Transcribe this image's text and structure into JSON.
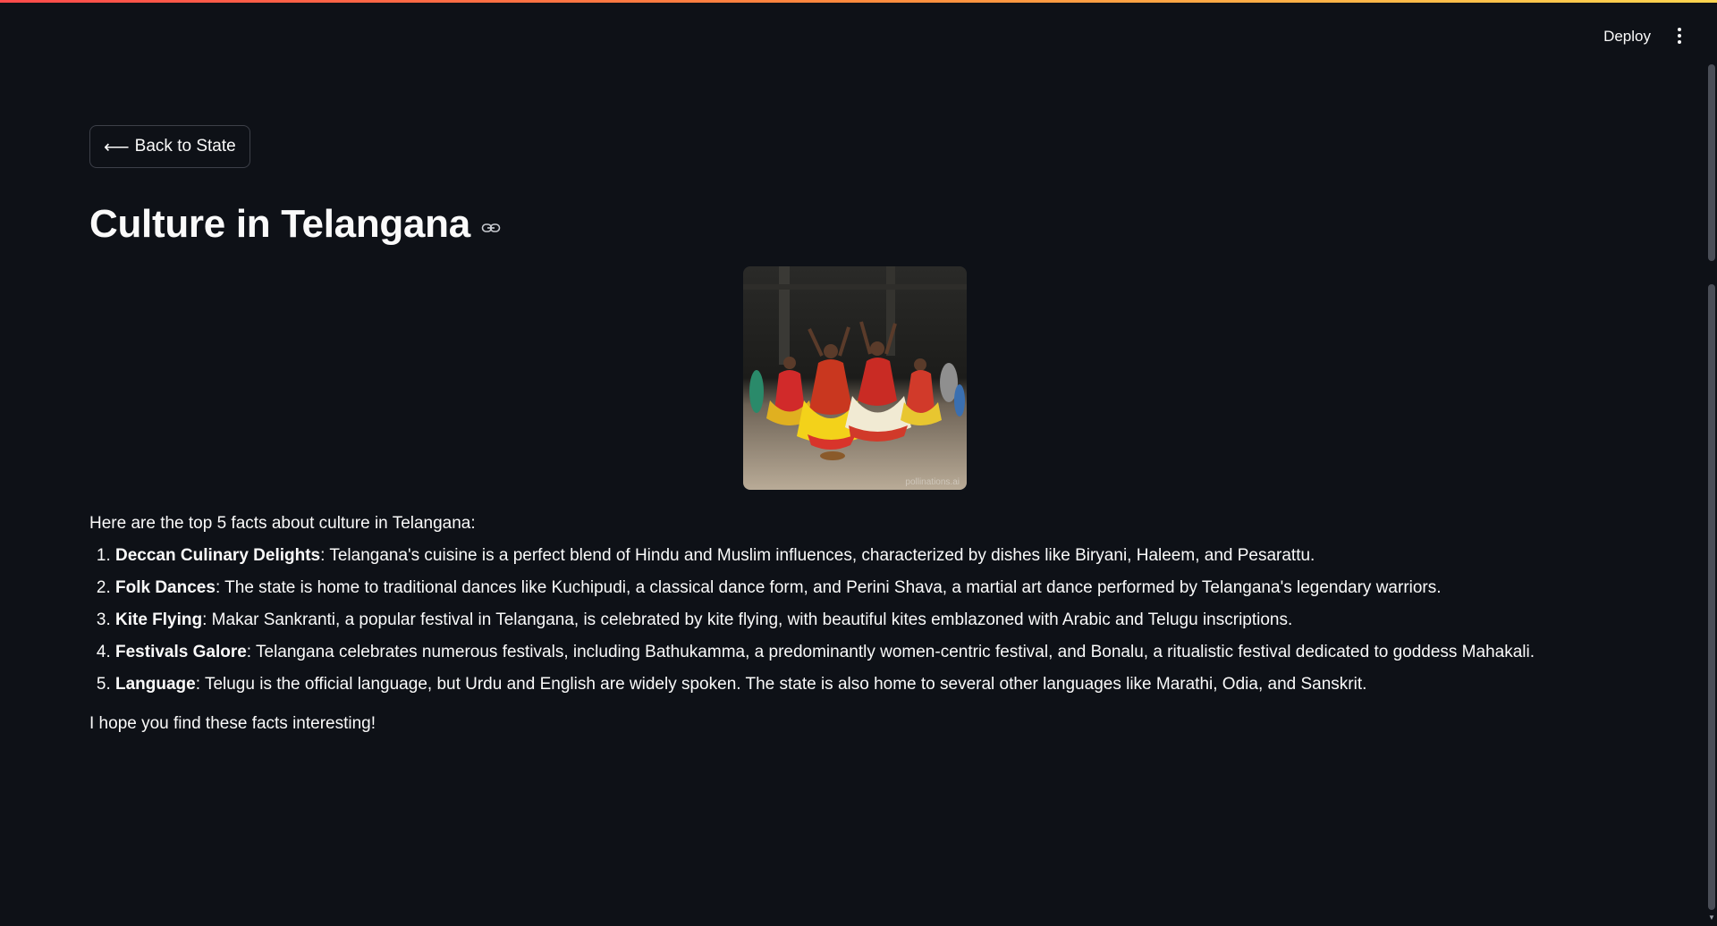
{
  "header": {
    "deploy_label": "Deploy",
    "menu_icon": "more-vertical-icon"
  },
  "colors": {
    "background": "#0e1117",
    "text": "#fafafa",
    "accent_gradient_start": "#ff4b4b",
    "accent_gradient_end": "#ffd54f",
    "border": "#3d4049"
  },
  "back_button": {
    "label": "Back to State",
    "icon": "arrow-left-icon",
    "arrow_glyph": "⟵"
  },
  "page": {
    "title": "Culture in Telangana",
    "link_icon": "link-icon",
    "image_watermark": "pollinations.ai",
    "intro": "Here are the top 5 facts about culture in Telangana:",
    "facts": [
      {
        "title": "Deccan Culinary Delights",
        "text": ": Telangana's cuisine is a perfect blend of Hindu and Muslim influences, characterized by dishes like Biryani, Haleem, and Pesarattu."
      },
      {
        "title": "Folk Dances",
        "text": ": The state is home to traditional dances like Kuchipudi, a classical dance form, and Perini Shava, a martial art dance performed by Telangana's legendary warriors."
      },
      {
        "title": "Kite Flying",
        "text": ": Makar Sankranti, a popular festival in Telangana, is celebrated by kite flying, with beautiful kites emblazoned with Arabic and Telugu inscriptions."
      },
      {
        "title": "Festivals Galore",
        "text": ": Telangana celebrates numerous festivals, including Bathukamma, a predominantly women-centric festival, and Bonalu, a ritualistic festival dedicated to goddess Mahakali."
      },
      {
        "title": "Language",
        "text": ": Telugu is the official language, but Urdu and English are widely spoken. The state is also home to several other languages like Marathi, Odia, and Sanskrit."
      }
    ],
    "outro": "I hope you find these facts interesting!"
  }
}
